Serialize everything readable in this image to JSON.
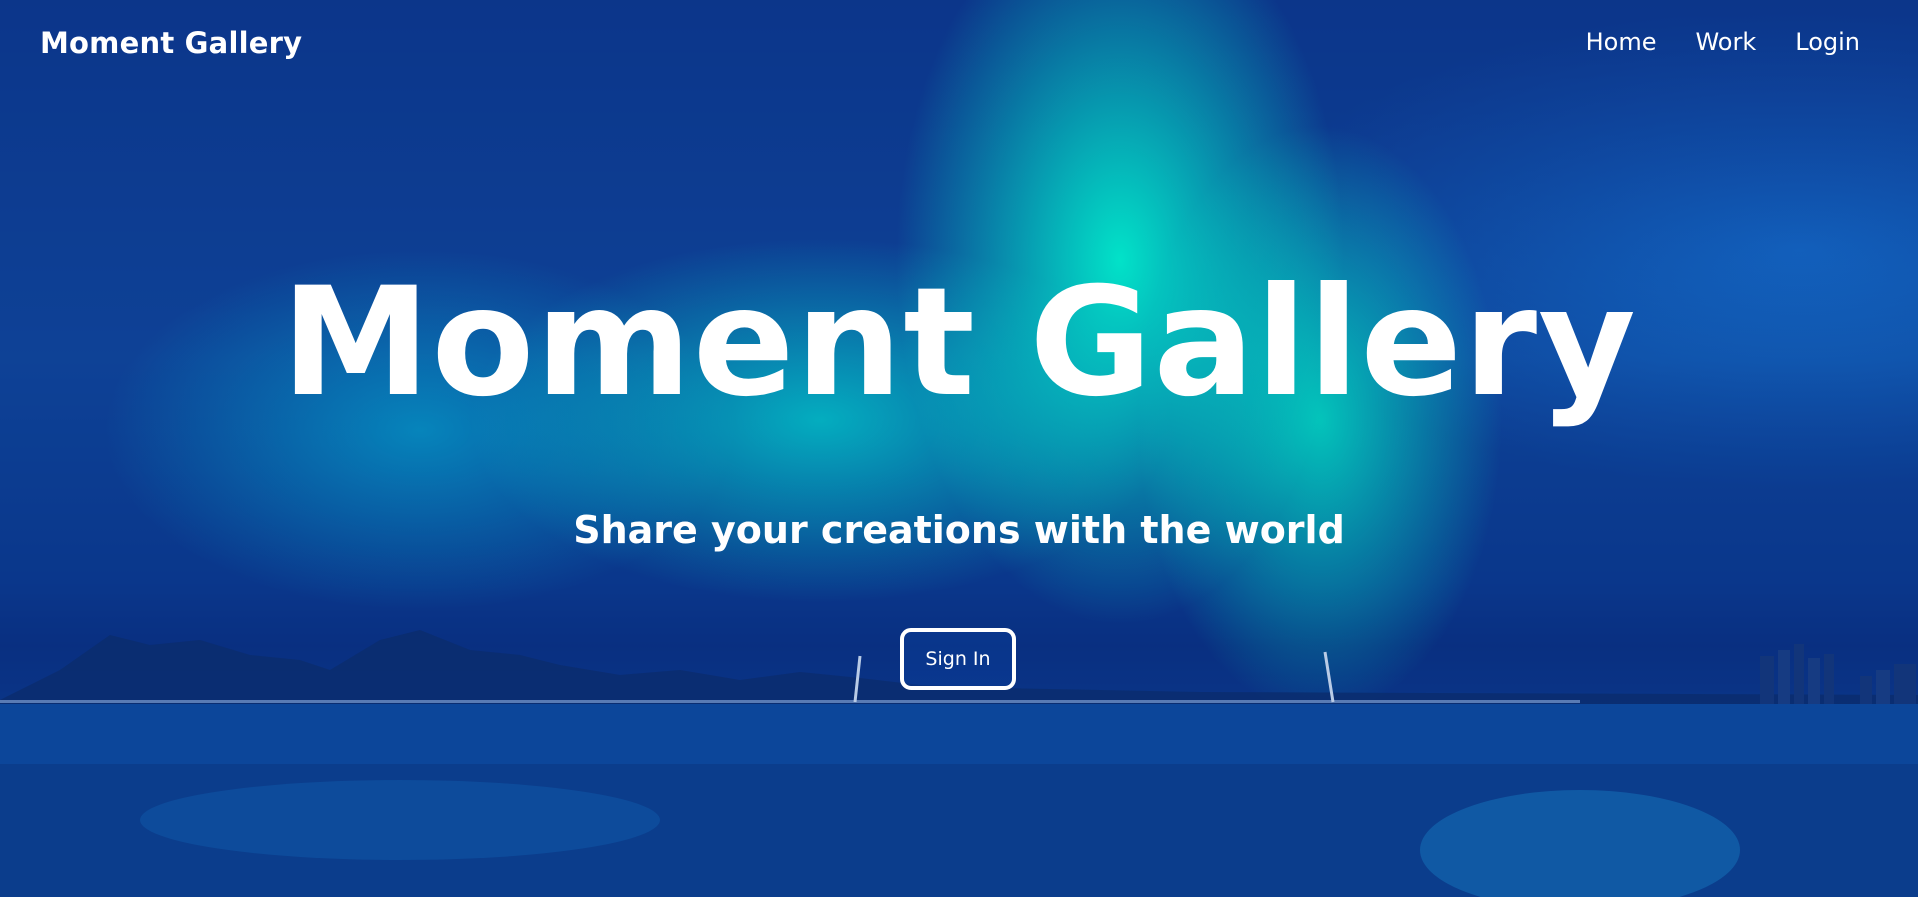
{
  "nav": {
    "brand": "Moment Gallery",
    "links": [
      "Home",
      "Work",
      "Login"
    ]
  },
  "hero": {
    "title": "Moment Gallery",
    "subtitle": "Share your creations with the world",
    "cta_label": "Sign In"
  },
  "colors": {
    "sky_top": "#0f4aa6",
    "aurora": "#00ffd2",
    "water": "#0b3f8e",
    "text": "#ffffff"
  }
}
